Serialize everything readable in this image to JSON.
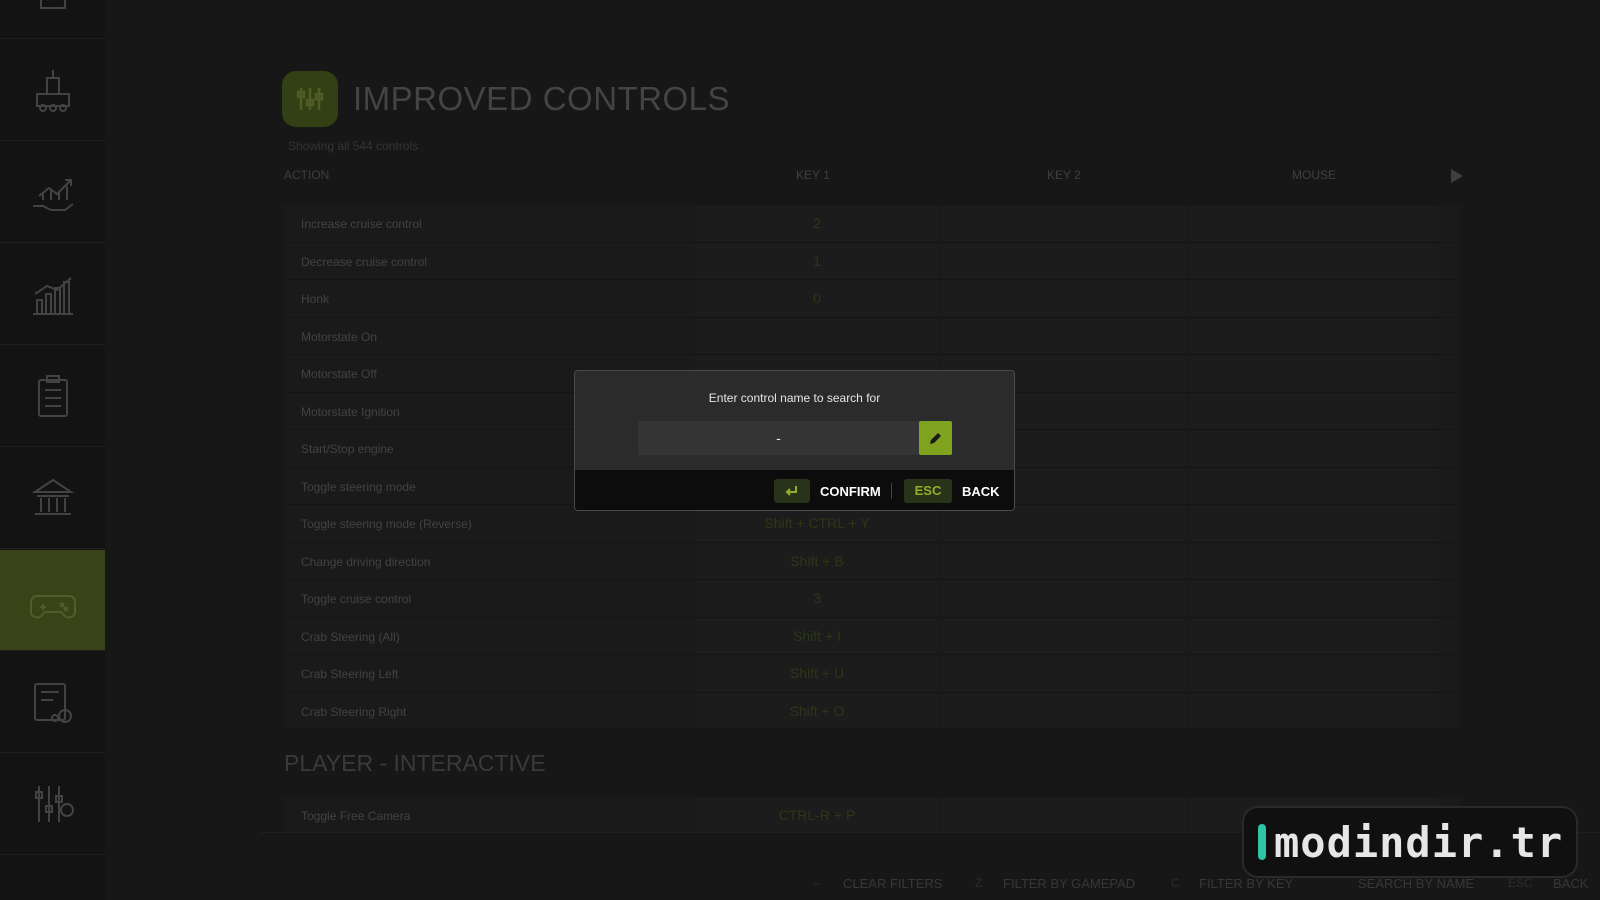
{
  "sidebar": {
    "items": [
      {
        "icon": "crop-icon"
      },
      {
        "icon": "factory-icon"
      },
      {
        "icon": "finance-hand-icon"
      },
      {
        "icon": "statistics-chart-icon"
      },
      {
        "icon": "checklist-icon"
      },
      {
        "icon": "bank-icon"
      },
      {
        "icon": "gamepad-icon",
        "active": true
      },
      {
        "icon": "vehicle-list-icon"
      },
      {
        "icon": "settings-sliders-icon"
      }
    ]
  },
  "header": {
    "title": "IMPROVED CONTROLS",
    "count_text": "Showing all 544 controls"
  },
  "columns": {
    "action": "ACTION",
    "key1": "KEY 1",
    "key2": "KEY 2",
    "mouse": "MOUSE"
  },
  "rows": [
    {
      "action": "Increase cruise control",
      "key1": "2"
    },
    {
      "action": "Decrease cruise control",
      "key1": "1"
    },
    {
      "action": "Honk",
      "key1": "0"
    },
    {
      "action": "Motorstate On",
      "key1": ""
    },
    {
      "action": "Motorstate Off",
      "key1": ""
    },
    {
      "action": "Motorstate Ignition",
      "key1": ""
    },
    {
      "action": "Start/Stop engine",
      "key1": ""
    },
    {
      "action": "Toggle steering mode",
      "key1": ""
    },
    {
      "action": "Toggle steering mode (Reverse)",
      "key1": "Shift + CTRL + Y"
    },
    {
      "action": "Change driving direction",
      "key1": "Shift + B"
    },
    {
      "action": "Toggle cruise control",
      "key1": "3"
    },
    {
      "action": "Crab Steering (All)",
      "key1": "Shift + I"
    },
    {
      "action": "Crab Steering Left",
      "key1": "Shift + U"
    },
    {
      "action": "Crab Steering Right",
      "key1": "Shift + O"
    }
  ],
  "section2": {
    "title": "PLAYER - INTERACTIVE",
    "rows": [
      {
        "action": "Toggle Free Camera",
        "key1": "CTRL-R + P"
      }
    ]
  },
  "bottom_bar": {
    "hints": [
      {
        "key": "–",
        "label": "CLEAR FILTERS"
      },
      {
        "key": "Z",
        "label": "FILTER BY GAMEPAD"
      },
      {
        "key": "C",
        "label": "FILTER BY KEY"
      },
      {
        "key": "",
        "label": "SEARCH BY NAME"
      },
      {
        "key": "ESC",
        "label": "BACK"
      }
    ]
  },
  "dialog": {
    "prompt": "Enter control name to search for",
    "input_value": "-",
    "confirm_label": "CONFIRM",
    "esc_key": "ESC",
    "back_label": "BACK",
    "accent": "#7fa21f"
  },
  "watermark": {
    "text": "modindir.tr"
  }
}
